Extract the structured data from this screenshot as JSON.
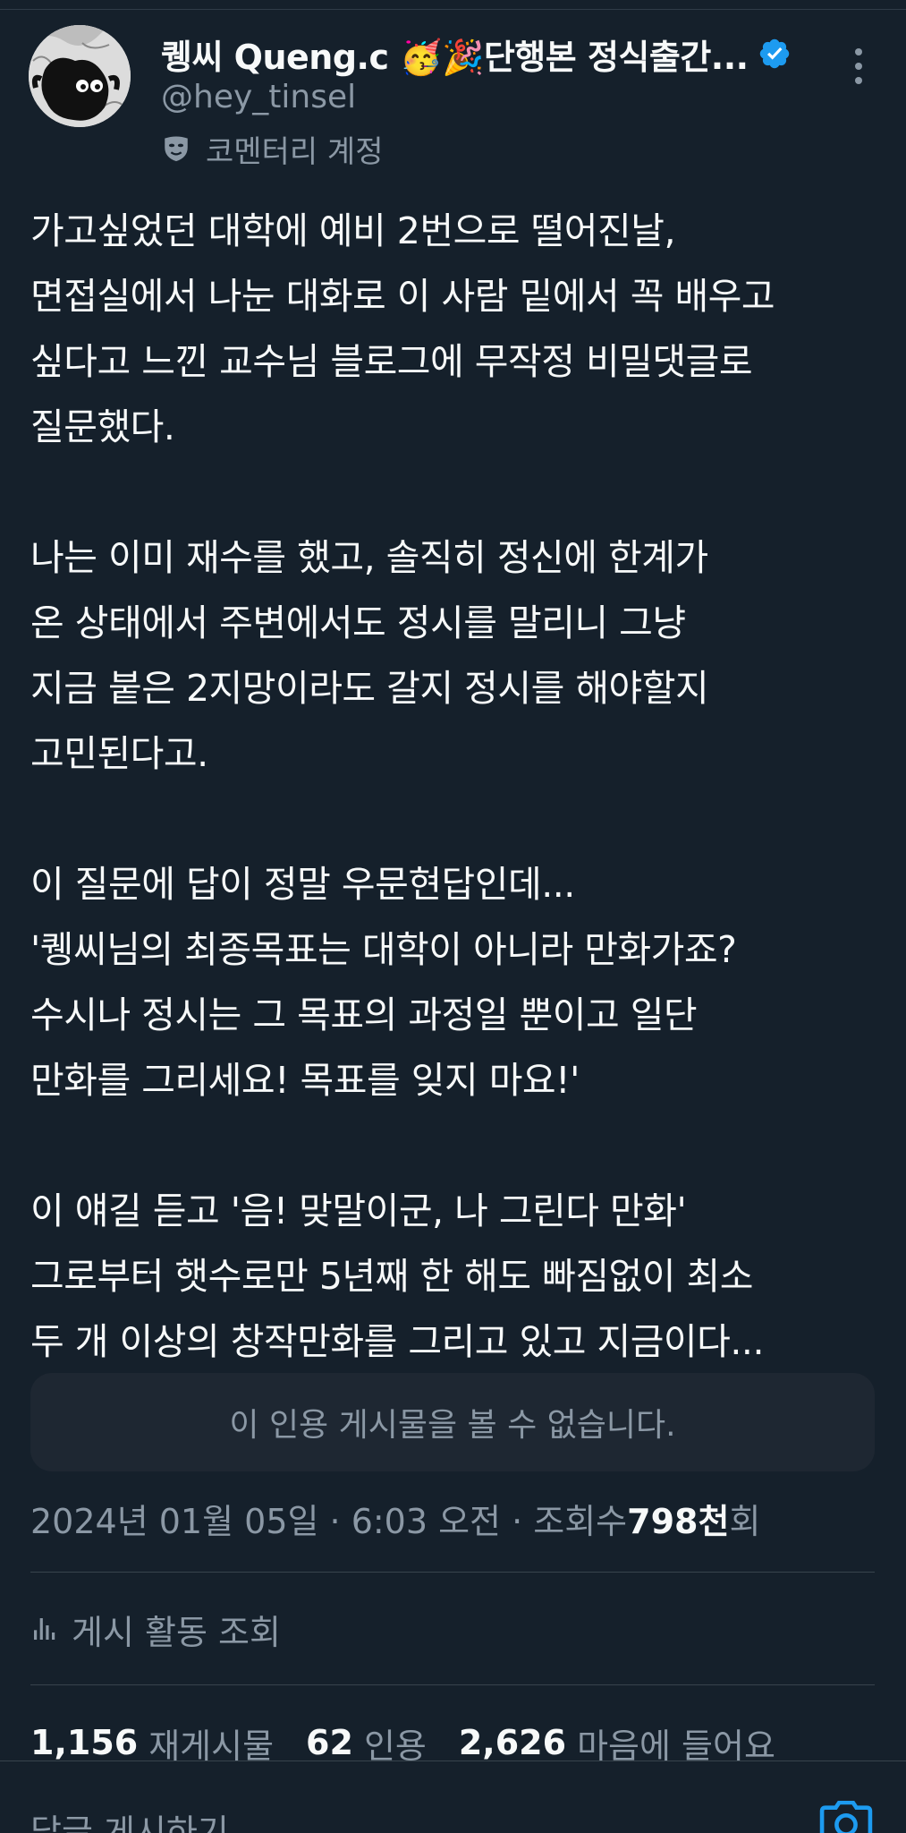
{
  "author": {
    "display_name": "퀭씨 Queng.c 🥳🎉단행본 정식출간...",
    "handle": "@hey_tinsel",
    "account_label": "코멘터리 계정",
    "verified_color": "#1d9bf0"
  },
  "tweet": {
    "paragraphs": [
      [
        "가고싶었던 대학에 예비 2번으로 떨어진날,",
        "면접실에서 나눈 대화로 이 사람 밑에서 꼭 배우고",
        "싶다고 느낀 교수님 블로그에 무작정 비밀댓글로",
        "질문했다."
      ],
      [
        "나는 이미 재수를 했고, 솔직히 정신에 한계가",
        "온 상태에서 주변에서도 정시를 말리니 그냥",
        "지금 붙은 2지망이라도 갈지 정시를 해야할지",
        "고민된다고."
      ],
      [
        "이 질문에 답이 정말 우문현답인데...",
        "'퀭씨님의 최종목표는 대학이 아니라 만화가죠?",
        "수시나 정시는 그 목표의 과정일 뿐이고 일단",
        "만화를 그리세요! 목표를 잊지 마요!'"
      ],
      [
        "이 얘길 듣고 '음! 맞말이군, 나 그린다 만화'",
        "그로부터 햇수로만 5년째 한 해도 빠짐없이 최소",
        "두 개 이상의 창작만화를 그리고 있고 지금이다..."
      ]
    ]
  },
  "quote_unavailable": "이 인용 게시물을 볼 수 없습니다.",
  "meta": {
    "timestamp": "2024년 01월 05일 · 6:03 오전 · 조회수 ",
    "views": "798천",
    "views_suffix": "회"
  },
  "activity_label": "게시 활동 조회",
  "stats": {
    "reposts": "1,156",
    "reposts_label": "재게시물",
    "quotes": "62",
    "quotes_label": "인용",
    "likes": "2,626",
    "likes_label": "마음에 들어요"
  },
  "reply": {
    "placeholder": "답글 게시하기"
  },
  "icons": {
    "more": "more-vertical-icon",
    "verified": "verified-badge-icon",
    "commentary": "mask-icon",
    "activity": "bar-chart-icon",
    "camera": "camera-icon"
  },
  "colors": {
    "background": "#15202b",
    "text": "#f7f9f9",
    "secondary": "#8b98a5",
    "accent": "#1d9bf0"
  }
}
